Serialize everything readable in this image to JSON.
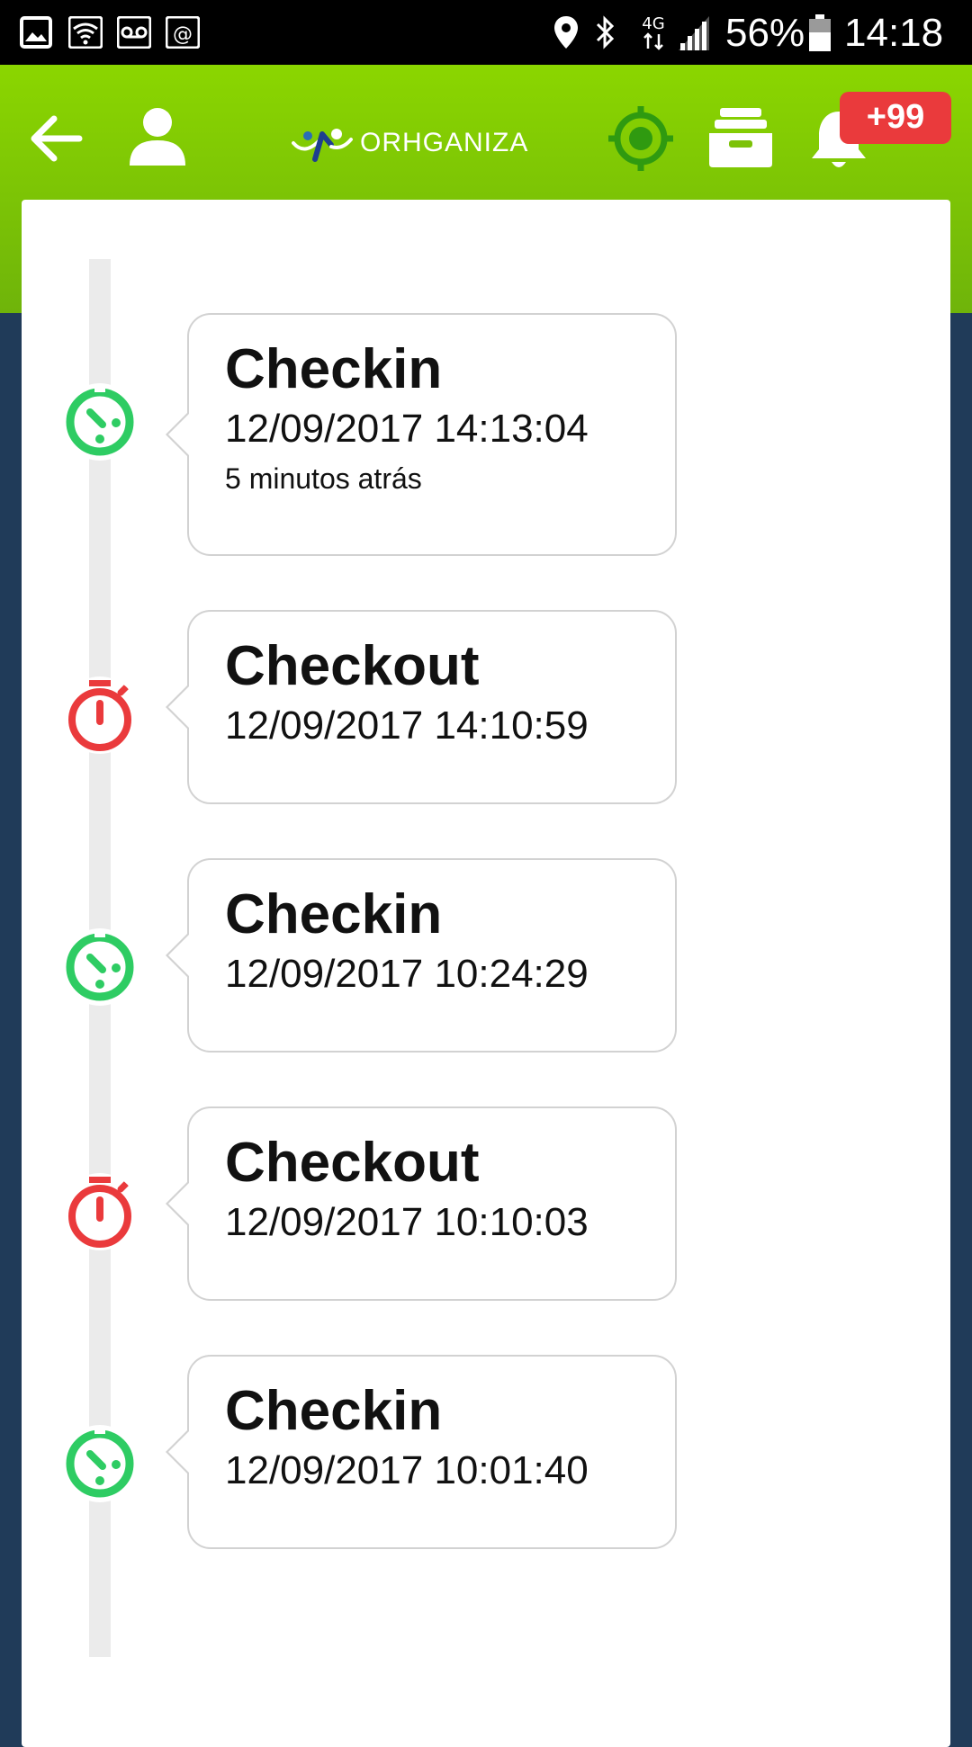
{
  "status_bar": {
    "battery_percent": "56%",
    "time": "14:18",
    "network": "4G",
    "icons": [
      "gallery-icon",
      "wifi-icon",
      "voicemail-icon",
      "screenshot-icon",
      "location-icon",
      "bluetooth-icon",
      "network-4g-icon",
      "signal-icon",
      "battery-icon"
    ]
  },
  "app_bar": {
    "brand": "ORHGANIZA",
    "notification_badge": "+99",
    "colors": {
      "bar_green": "#8bd600",
      "target_green": "#2f9a10",
      "badge_red": "#ea3a3c"
    },
    "icons": [
      "back-arrow-icon",
      "user-icon",
      "target-icon",
      "inbox-icon",
      "bell-icon"
    ]
  },
  "timeline": {
    "colors": {
      "checkin": "#2ecc63",
      "checkout": "#ea3a3c",
      "rail": "#ebebeb",
      "background": "#203b59"
    },
    "events": [
      {
        "type": "checkin",
        "title": "Checkin",
        "datetime": "12/09/2017 14:13:04",
        "relative": "5 minutos atrás"
      },
      {
        "type": "checkout",
        "title": "Checkout",
        "datetime": "12/09/2017 14:10:59"
      },
      {
        "type": "checkin",
        "title": "Checkin",
        "datetime": "12/09/2017 10:24:29"
      },
      {
        "type": "checkout",
        "title": "Checkout",
        "datetime": "12/09/2017 10:10:03"
      },
      {
        "type": "checkin",
        "title": "Checkin",
        "datetime": "12/09/2017 10:01:40"
      }
    ]
  }
}
